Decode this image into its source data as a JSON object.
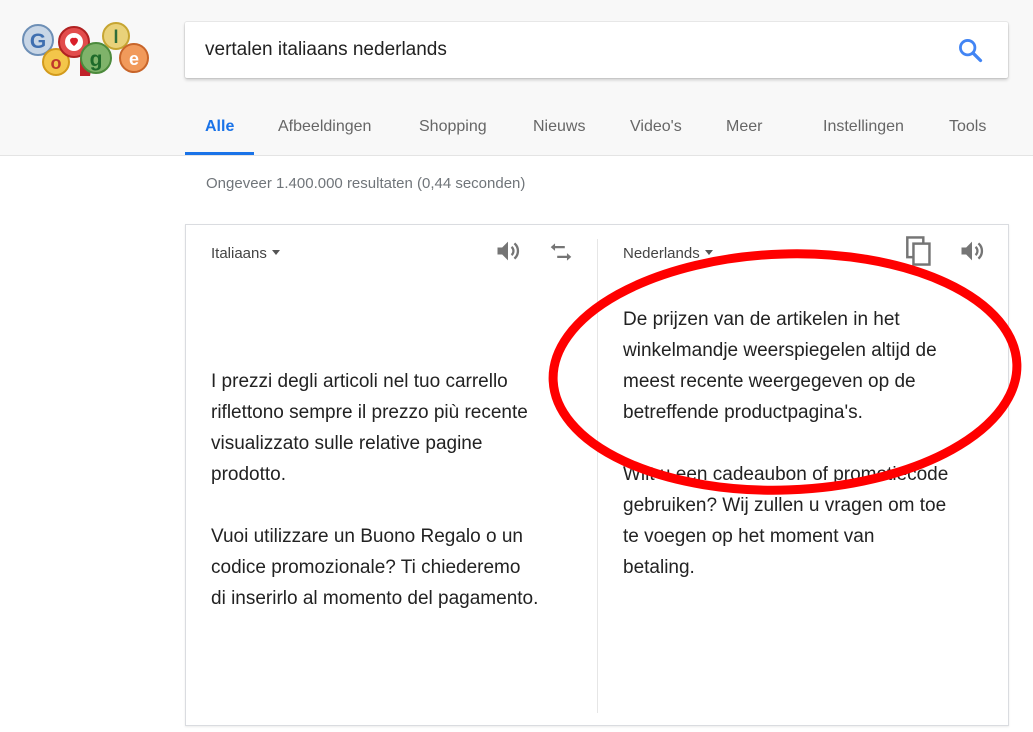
{
  "search": {
    "query": "vertalen italiaans nederlands",
    "placeholder": ""
  },
  "logo": {
    "letters": [
      "G",
      "o",
      "o",
      "g",
      "l",
      "e"
    ]
  },
  "tabs": [
    {
      "label": "Alle",
      "active": true
    },
    {
      "label": "Afbeeldingen"
    },
    {
      "label": "Shopping"
    },
    {
      "label": "Nieuws"
    },
    {
      "label": "Video's"
    },
    {
      "label": "Meer"
    },
    {
      "label": "Instellingen"
    },
    {
      "label": "Tools"
    }
  ],
  "results_stats": "Ongeveer 1.400.000 resultaten (0,44 seconden)",
  "translator": {
    "source": {
      "language": "Italiaans",
      "lines_p1": [
        "I prezzi degli articoli nel tuo carrello",
        "riflettono sempre il prezzo più recente",
        "visualizzato sulle relative pagine",
        "prodotto."
      ],
      "lines_p2": [
        "Vuoi utilizzare un Buono Regalo o un",
        "codice promozionale? Ti chiederemo",
        "di inserirlo al momento del pagamento."
      ]
    },
    "target": {
      "language": "Nederlands",
      "lines_p1": [
        "De prijzen van de artikelen in het",
        "winkelmandje weerspiegelen altijd de",
        "meest recente weergegeven op de",
        "betreffende productpagina's."
      ],
      "lines_p2": [
        "Wilt u een cadeaubon of promotiecode",
        "gebruiken? Wij zullen u vragen om toe",
        "te voegen op het moment van",
        "betaling."
      ]
    }
  },
  "icons": {
    "search": "search-icon",
    "speaker": "speaker-icon",
    "swap": "swap-icon",
    "copy": "copy-icon"
  },
  "colors": {
    "accent": "#1a73e8",
    "annotation": "#ff0000",
    "icon_gray": "#757575"
  }
}
